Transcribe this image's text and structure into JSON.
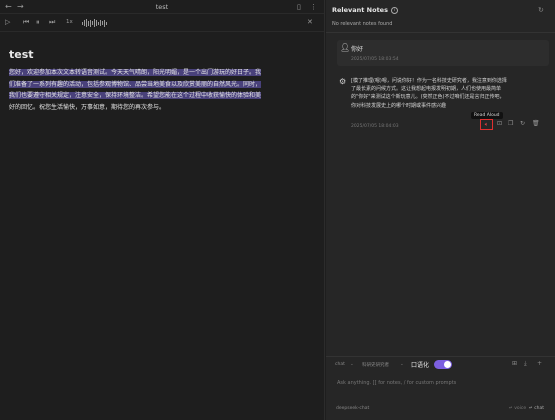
{
  "editor": {
    "tab_title": "test",
    "speed": "1x",
    "doc_title": "test",
    "paragraph_lines": [
      "您好，欢迎参加本次文本转语音测试。今天天气晴朗，阳光明媚，是一个出门游玩的好日子。我",
      "们准备了一系列有趣的活动，包括参观博物馆、品尝当地美食以及欣赏美丽的自然风光。同时，",
      "我们也要遵守相关规定，注意安全，保持环境整洁。希望您能在这个过程中收获愉快的体验和美",
      "好的回忆。祝您生活愉快，万事如意，期待您的再次参与。"
    ]
  },
  "panel": {
    "header": "Relevant Notes",
    "empty_text": "No relevant notes found",
    "user_message": "你好",
    "user_time": "2025/07/05 18:03:54",
    "bot_lines": [
      "[模了推理(嗯)嗯，问说你好！作为一名科技史研究者，我注意到你选择",
      "了最长素的问候方式。这让我想起电报发明初期，人们也使用最简单",
      "的\"你好\"来测试这个新玩意儿。(突然正色)不过咱们还是言归正传吧，",
      "你对科技发展史上的哪个时期或事件感兴趣"
    ],
    "tooltip": "Read Aloud",
    "bot_time": "2025/07/05 18:04:03",
    "bottom": {
      "mode": "chat",
      "option": "科研史研究者",
      "switch_label": "口语化",
      "placeholder": "Ask anything. [[ for notes, / for custom prompts",
      "model": "deepseek-chat",
      "send_hint_a": "↵ voice",
      "send_hint_b": "↵ chat"
    }
  }
}
